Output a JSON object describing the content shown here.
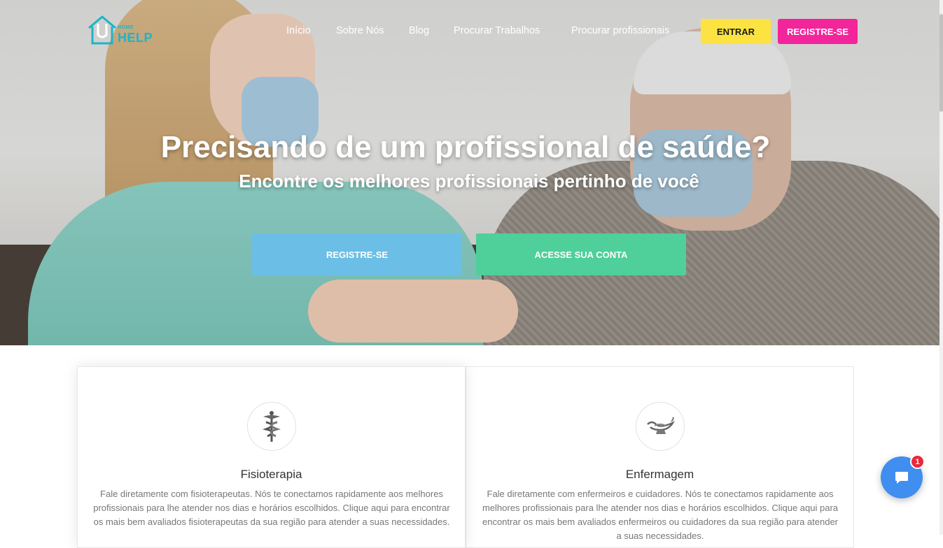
{
  "nav": {
    "logo_small": "HOME",
    "logo_main": "HELP",
    "links": [
      "Início",
      "Sobre Nós",
      "Blog",
      "Procurar Trabalhos",
      "Procurar profissionais"
    ],
    "login_label": "ENTRAR",
    "register_label": "REGISTRE-SE"
  },
  "hero": {
    "title": "Precisando de um profissional de saúde?",
    "subtitle": "Encontre os melhores profissionais pertinho de você",
    "cta_register": "REGISTRE-SE",
    "cta_account": "ACESSE SUA CONTA"
  },
  "services": [
    {
      "icon": "caduceus-icon",
      "title": "Fisioterapia",
      "text": "Fale diretamente com fisioterapeutas. Nós te conectamos rapidamente aos melhores profissionais para lhe atender nos dias e horários escolhidos. Clique aqui para encontrar os mais bem avaliados fisioterapeutas da sua região para atender a suas necessidades."
    },
    {
      "icon": "nursing-lamp-icon",
      "title": "Enfermagem",
      "text": "Fale diretamente com enfermeiros e cuidadores. Nós te conectamos rapidamente aos melhores profissionais para lhe atender nos dias e horários escolhidos. Clique aqui para encontrar os mais bem avaliados enfermeiros ou cuidadores da sua região para atender a suas necessidades."
    }
  ],
  "chat": {
    "icon": "chat-bubble-icon",
    "badge_count": "1"
  },
  "colors": {
    "brand_teal": "#1db4c9",
    "login_yellow": "#fde341",
    "register_pink": "#f3259a",
    "cta_blue": "#6bbfe6",
    "cta_green": "#4fcf9a",
    "chat_blue": "#3f8ef0"
  }
}
